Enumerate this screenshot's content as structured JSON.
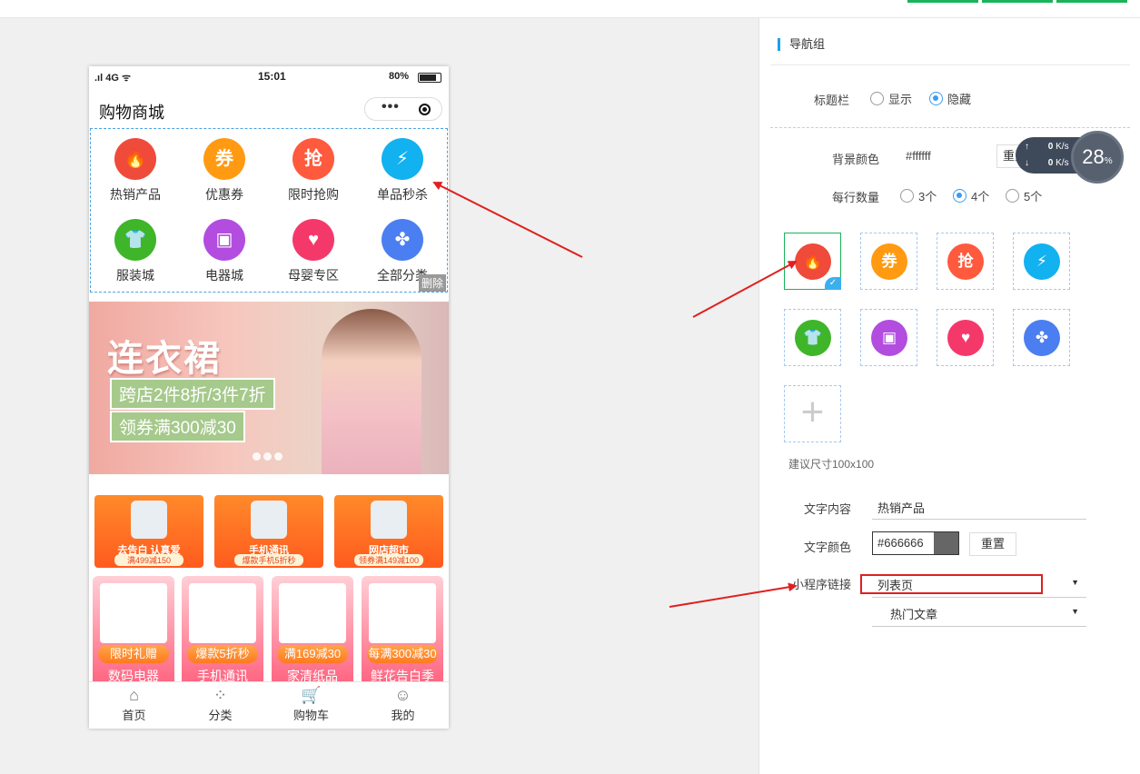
{
  "phone": {
    "status": {
      "signal": ".ıl 4G ᯤ",
      "time": "15:01",
      "battery": "80%"
    },
    "header_title": "购物商城",
    "capsule_dots": "•••",
    "nav": [
      {
        "label": "热销产品",
        "icon": "fire-icon",
        "color": "#f04a3a",
        "glyph": "🔥"
      },
      {
        "label": "优惠券",
        "icon": "coupon-icon",
        "color": "#ff9a12",
        "glyph": "券"
      },
      {
        "label": "限时抢购",
        "icon": "flash-buy-icon",
        "color": "#ff5a3d",
        "glyph": "抢"
      },
      {
        "label": "单品秒杀",
        "icon": "lightning-icon",
        "color": "#12b1f0",
        "glyph": "⚡"
      },
      {
        "label": "服装城",
        "icon": "shirt-icon",
        "color": "#3fb52a",
        "glyph": "👕"
      },
      {
        "label": "电器城",
        "icon": "appliance-icon",
        "color": "#b24de0",
        "glyph": "▣"
      },
      {
        "label": "母婴专区",
        "icon": "baby-icon",
        "color": "#f5386a",
        "glyph": "♥"
      },
      {
        "label": "全部分类",
        "icon": "category-icon",
        "color": "#4b7ef0",
        "glyph": "✤"
      }
    ],
    "delete_label": "删除",
    "banner": {
      "title": "连衣裙",
      "line1": "跨店2件8折/3件7折",
      "line2": "领券满300减30"
    },
    "promos": [
      {
        "title": "去告白 认真爱",
        "sub": "满499减150"
      },
      {
        "title": "手机通讯",
        "sub": "爆款手机5折秒"
      },
      {
        "title": "网店超市",
        "sub": "领券满149减100"
      }
    ],
    "cards": [
      {
        "tag": "限时礼赠",
        "cat": "数码电器"
      },
      {
        "tag": "爆款5折秒",
        "cat": "手机通讯"
      },
      {
        "tag": "满169减30",
        "cat": "家清纸品"
      },
      {
        "tag": "每满300减30",
        "cat": "鲜花告白季"
      }
    ],
    "tabs": [
      {
        "label": "首页",
        "glyph": "⌂"
      },
      {
        "label": "分类",
        "glyph": "⁘"
      },
      {
        "label": "购物车",
        "glyph": "🛒"
      },
      {
        "label": "我的",
        "glyph": "☺"
      }
    ]
  },
  "panel": {
    "title": "导航组",
    "titlebar_label": "标题栏",
    "titlebar_show": "显示",
    "titlebar_hide": "隐藏",
    "bg_label": "背景颜色",
    "bg_value": "#ffffff",
    "reset_label": "重置",
    "per_row_label": "每行数量",
    "per_row_options": [
      "3个",
      "4个",
      "5个"
    ],
    "hint": "建议尺寸100x100",
    "text_content_label": "文字内容",
    "text_content_value": "热销产品",
    "text_color_label": "文字颜色",
    "text_color_value": "#666666",
    "text_color_reset": "重置",
    "link_label": "小程序链接",
    "link_select1": "列表页",
    "link_select2": "热门文章",
    "speed": {
      "up": "0",
      "down": "0",
      "unit": "K/s",
      "percent": "28",
      "percent_unit": "%"
    }
  }
}
